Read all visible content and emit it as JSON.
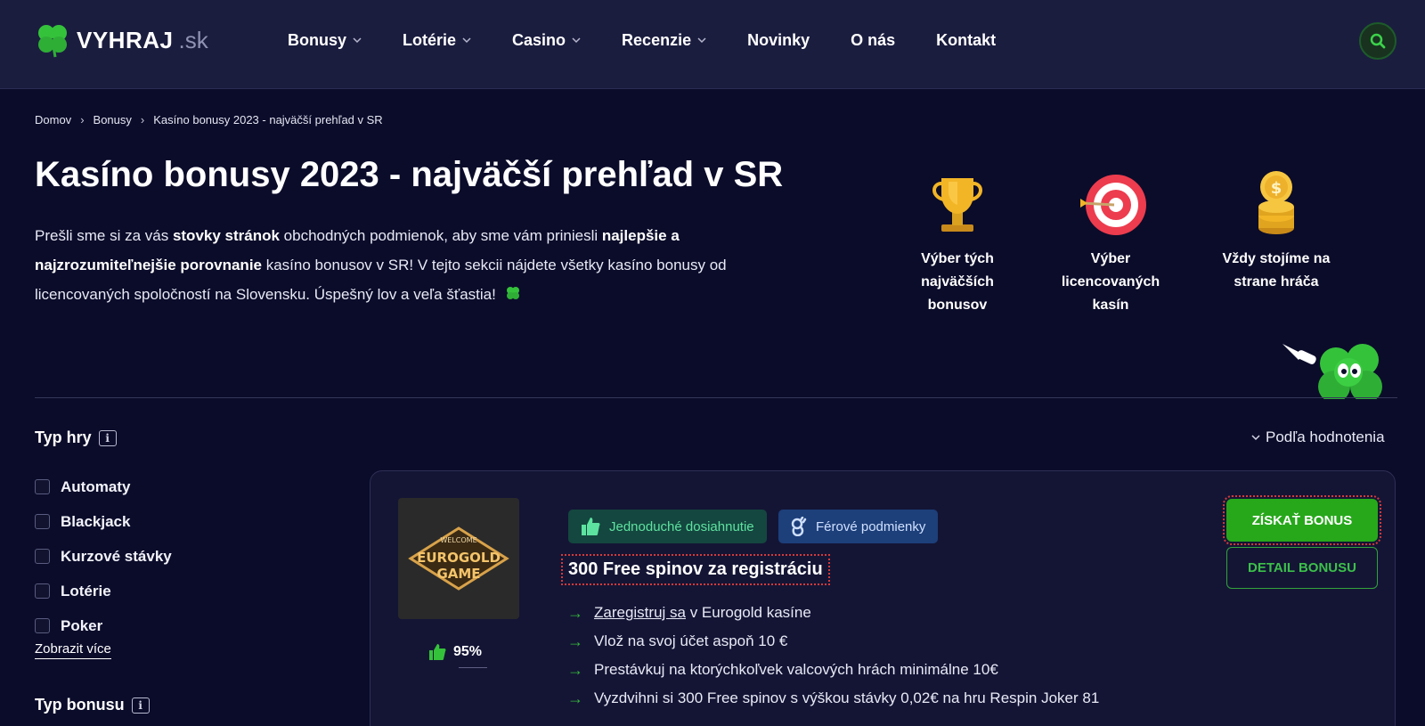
{
  "header": {
    "logo_text": "VYHRAJ",
    "logo_tld": ".sk",
    "nav": [
      {
        "label": "Bonusy",
        "has_dropdown": true
      },
      {
        "label": "Lotérie",
        "has_dropdown": true
      },
      {
        "label": "Casino",
        "has_dropdown": true
      },
      {
        "label": "Recenzie",
        "has_dropdown": true
      },
      {
        "label": "Novinky",
        "has_dropdown": false
      },
      {
        "label": "O nás",
        "has_dropdown": false
      },
      {
        "label": "Kontakt",
        "has_dropdown": false
      }
    ],
    "search_icon": "search-icon"
  },
  "breadcrumb": [
    "Domov",
    "Bonusy",
    "Kasíno bonusy 2023 - najväčší prehľad v SR"
  ],
  "hero": {
    "title": "Kasíno bonusy 2023 - najväčší prehľad v SR",
    "intro_parts": [
      {
        "text": "Prešli sme si za vás ",
        "bold": false
      },
      {
        "text": "stovky stránok",
        "bold": true
      },
      {
        "text": " obchodných podmienok, aby sme vám priniesli ",
        "bold": false
      },
      {
        "text": "najlepšie a najzrozumiteľnejšie porovnanie",
        "bold": true
      },
      {
        "text": " kasíno bonusov v SR! V tejto sekcii nájdete všetky kasíno bonusy od licencovaných spoločností na Slovensku. Úspešný lov a veľa šťastia!",
        "bold": false
      }
    ],
    "features": [
      {
        "icon": "trophy-icon",
        "label": "Výber tých najväčších bonusov"
      },
      {
        "icon": "target-icon",
        "label": "Výber licencovaných kasín"
      },
      {
        "icon": "coins-icon",
        "label": "Vždy stojíme na strane hráča"
      }
    ]
  },
  "filters": {
    "game_type_title": "Typ hry",
    "game_types": [
      "Automaty",
      "Blackjack",
      "Kurzové stávky",
      "Lotérie",
      "Poker"
    ],
    "show_more": "Zobrazit více",
    "bonus_type_title": "Typ bonusu"
  },
  "sort": {
    "label": "Podľa hodnotenia"
  },
  "bonus_card": {
    "casino_logo_line1": "WELCOME",
    "casino_logo_line2": "EUROGOLD",
    "casino_logo_line3": "GAME",
    "rating": "95%",
    "tags": [
      "Jednoduché dosiahnutie",
      "Férové podmienky"
    ],
    "title": "300 Free spinov za registráciu",
    "steps": [
      {
        "link": "Zaregistruj sa",
        "text": " v Eurogold kasíne"
      },
      {
        "link": "",
        "text": "Vlož na svoj účet aspoň 10 €"
      },
      {
        "link": "",
        "text": "Prestávkuj na ktorýchkoľvek valcových hrách minimálne 10€"
      },
      {
        "link": "",
        "text": "Vyzdvihni si 300 Free spinov s výškou stávky 0,02€ na hru Respin Joker 81"
      }
    ],
    "primary_button": "ZÍSKAŤ BONUS",
    "secondary_button": "DETAIL BONUSU"
  },
  "colors": {
    "background": "#0b0c2a",
    "header": "#1b1d3f",
    "accent_green": "#27a81b",
    "card": "#141535"
  }
}
